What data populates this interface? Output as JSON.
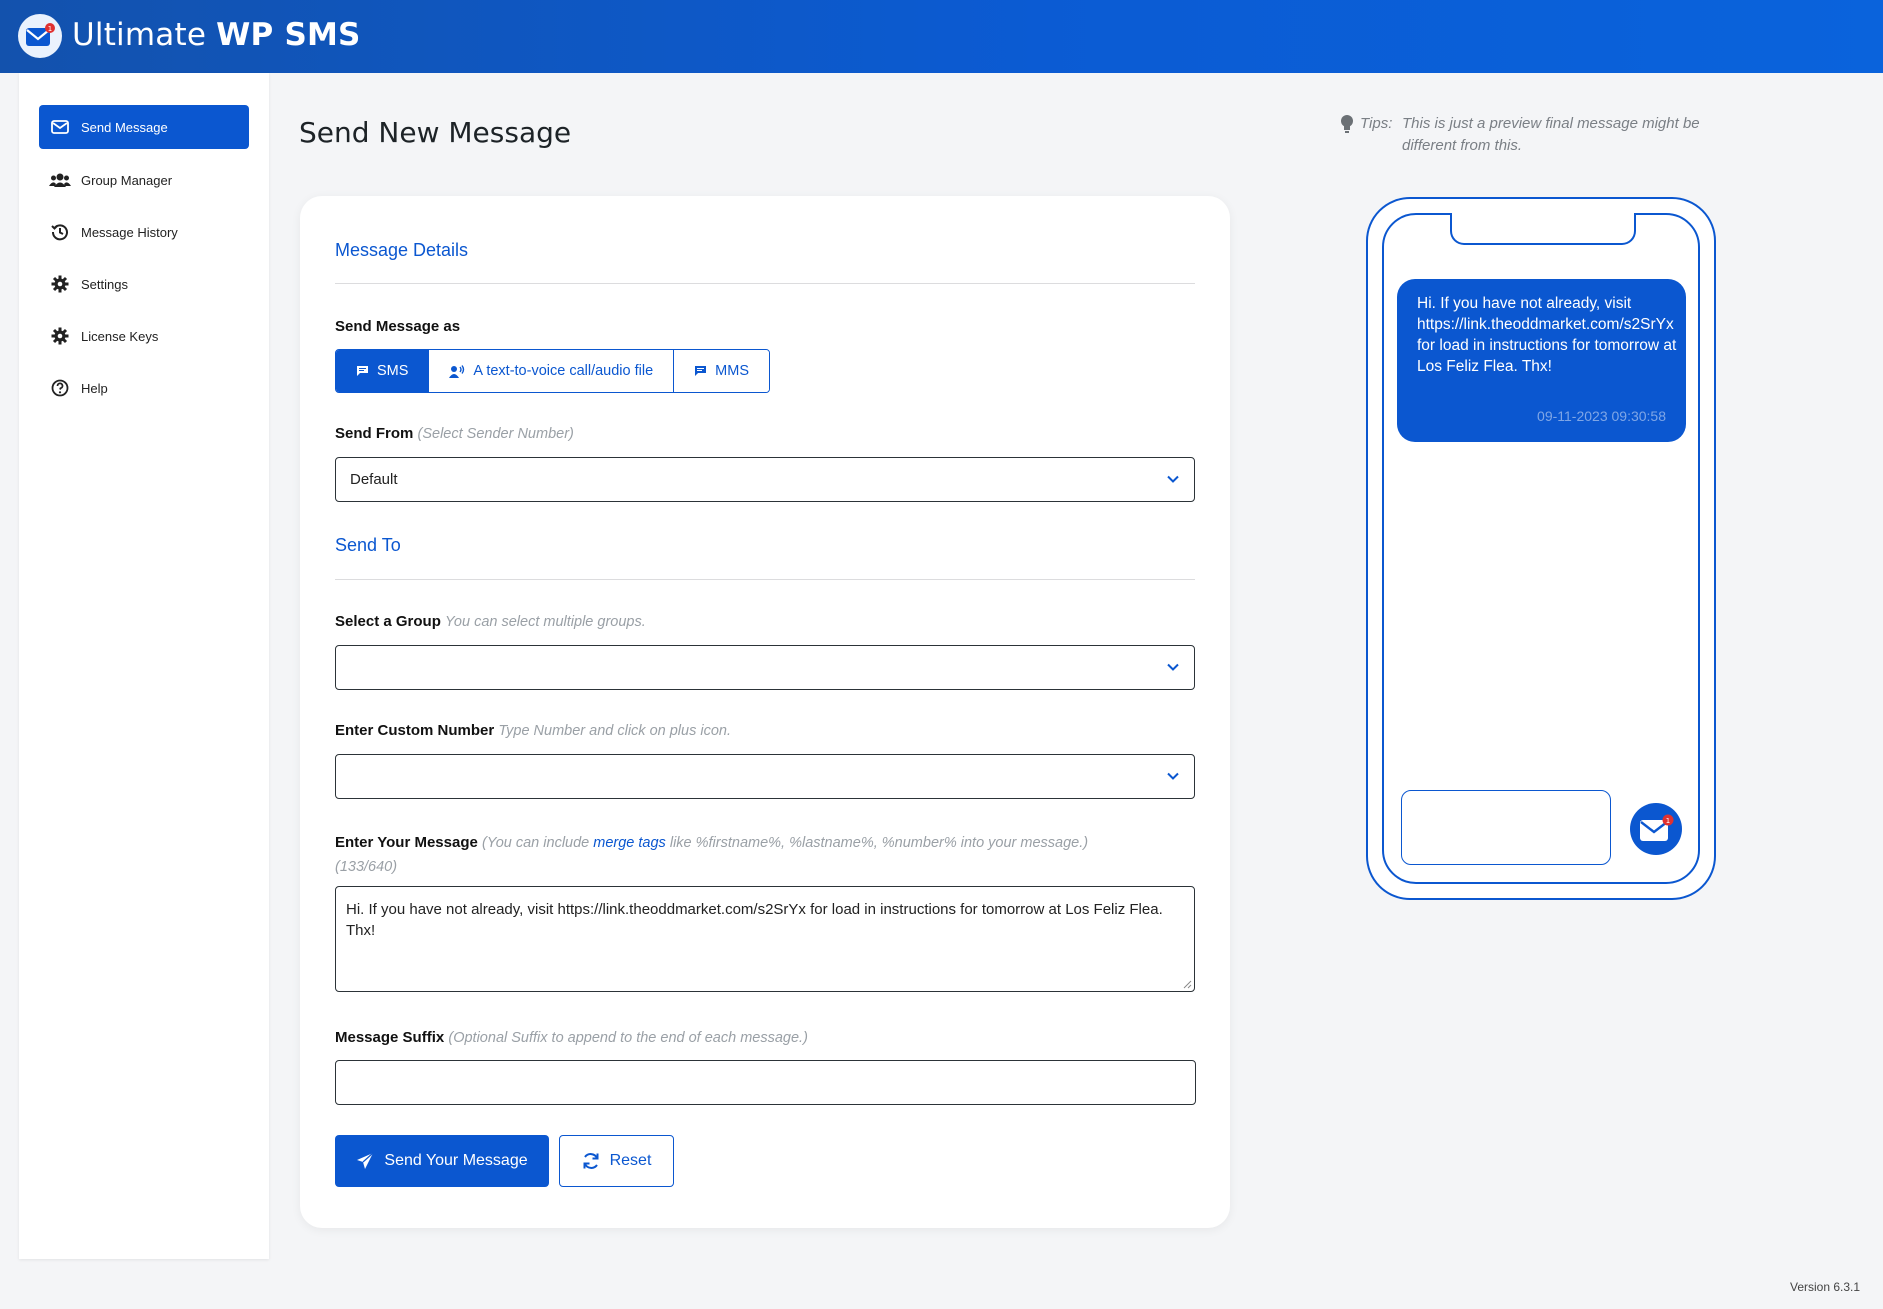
{
  "app": {
    "name_light": "Ultimate",
    "name_bold": "WP SMS"
  },
  "sidebar": {
    "items": [
      {
        "label": "Send Message",
        "icon": "envelope-icon",
        "active": true
      },
      {
        "label": "Group Manager",
        "icon": "users-icon"
      },
      {
        "label": "Message History",
        "icon": "history-icon"
      },
      {
        "label": "Settings",
        "icon": "gear-icon"
      },
      {
        "label": "License Keys",
        "icon": "gear-icon"
      },
      {
        "label": "Help",
        "icon": "help-icon"
      }
    ]
  },
  "page": {
    "title": "Send New Message"
  },
  "form": {
    "details_title": "Message Details",
    "send_as_label": "Send Message as",
    "send_as_options": [
      {
        "label": "SMS",
        "icon": "chat-icon",
        "active": true
      },
      {
        "label": "A text-to-voice call/audio file",
        "icon": "voice-icon"
      },
      {
        "label": "MMS",
        "icon": "chat-icon"
      }
    ],
    "send_from_label": "Send From",
    "send_from_hint": "(Select Sender Number)",
    "send_from_value": "Default",
    "send_to_title": "Send To",
    "group_label": "Select a Group",
    "group_hint": "You can select multiple groups.",
    "group_value": "",
    "custom_label": "Enter Custom Number",
    "custom_hint": "Type Number and click on plus icon.",
    "custom_value": "",
    "message_label": "Enter Your Message",
    "message_hint_pre": "(You can include ",
    "message_hint_link": "merge tags",
    "message_hint_post": " like %firstname%, %lastname%, %number% into your message.)",
    "message_count": "(133/640)",
    "message_value": "Hi. If you have not already, visit https://link.theoddmarket.com/s2SrYx for load in instructions for tomorrow at Los Feliz Flea. Thx!",
    "suffix_label": "Message Suffix",
    "suffix_hint": "(Optional Suffix to append to the end of each message.)",
    "suffix_value": "",
    "send_button": "Send Your Message",
    "reset_button": "Reset"
  },
  "preview": {
    "tips_label": "Tips:",
    "tips_text": "This is just a preview final message might be different from this.",
    "message": "Hi. If you have not already, visit https://link.theoddmarket.com/s2SrYx for load in instructions for tomorrow at Los Feliz Flea. Thx!",
    "timestamp": "09-11-2023 09:30:58"
  },
  "footer": {
    "version": "Version 6.3.1"
  },
  "colors": {
    "primary": "#0b57d0",
    "header": "#1352ad"
  }
}
